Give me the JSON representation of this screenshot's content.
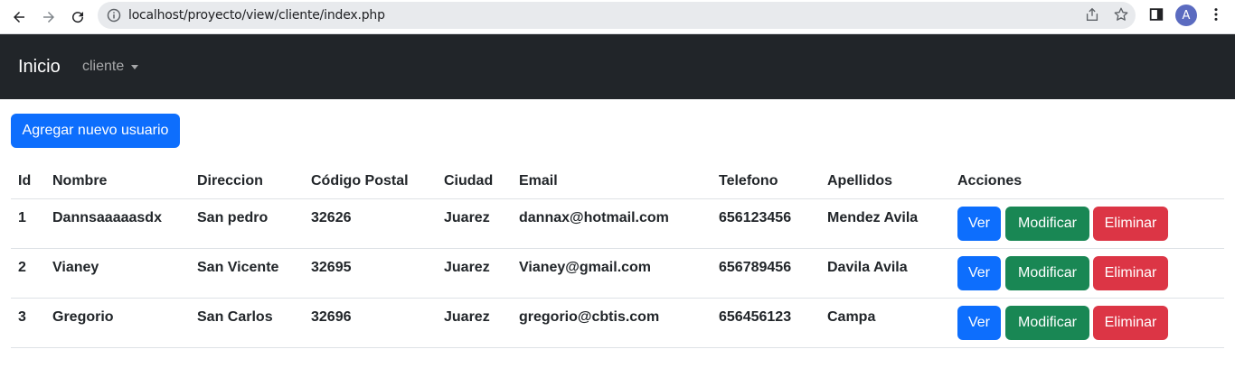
{
  "browser": {
    "url": "localhost/proyecto/view/cliente/index.php",
    "avatar_letter": "A"
  },
  "navbar": {
    "brand": "Inicio",
    "dropdown_label": "cliente"
  },
  "actions": {
    "add_user": "Agregar nuevo usuario"
  },
  "table": {
    "headers": {
      "id": "Id",
      "nombre": "Nombre",
      "direccion": "Direccion",
      "codigo_postal": "Código Postal",
      "ciudad": "Ciudad",
      "email": "Email",
      "telefono": "Telefono",
      "apellidos": "Apellidos",
      "acciones": "Acciones"
    },
    "rows": [
      {
        "id": "1",
        "nombre": "Dannsaaaaasdx",
        "direccion": "San pedro",
        "codigo_postal": "32626",
        "ciudad": "Juarez",
        "email": "dannax@hotmail.com",
        "telefono": "656123456",
        "apellidos": "Mendez Avila"
      },
      {
        "id": "2",
        "nombre": "Vianey",
        "direccion": "San Vicente",
        "codigo_postal": "32695",
        "ciudad": "Juarez",
        "email": "Vianey@gmail.com",
        "telefono": "656789456",
        "apellidos": "Davila Avila"
      },
      {
        "id": "3",
        "nombre": "Gregorio",
        "direccion": "San Carlos",
        "codigo_postal": "32696",
        "ciudad": "Juarez",
        "email": "gregorio@cbtis.com",
        "telefono": "656456123",
        "apellidos": "Campa"
      }
    ],
    "row_buttons": {
      "ver": "Ver",
      "modificar": "Modificar",
      "eliminar": "Eliminar"
    }
  },
  "colors": {
    "navbar_bg": "#212529",
    "primary": "#0d6efd",
    "success": "#198754",
    "danger": "#dc3545"
  }
}
